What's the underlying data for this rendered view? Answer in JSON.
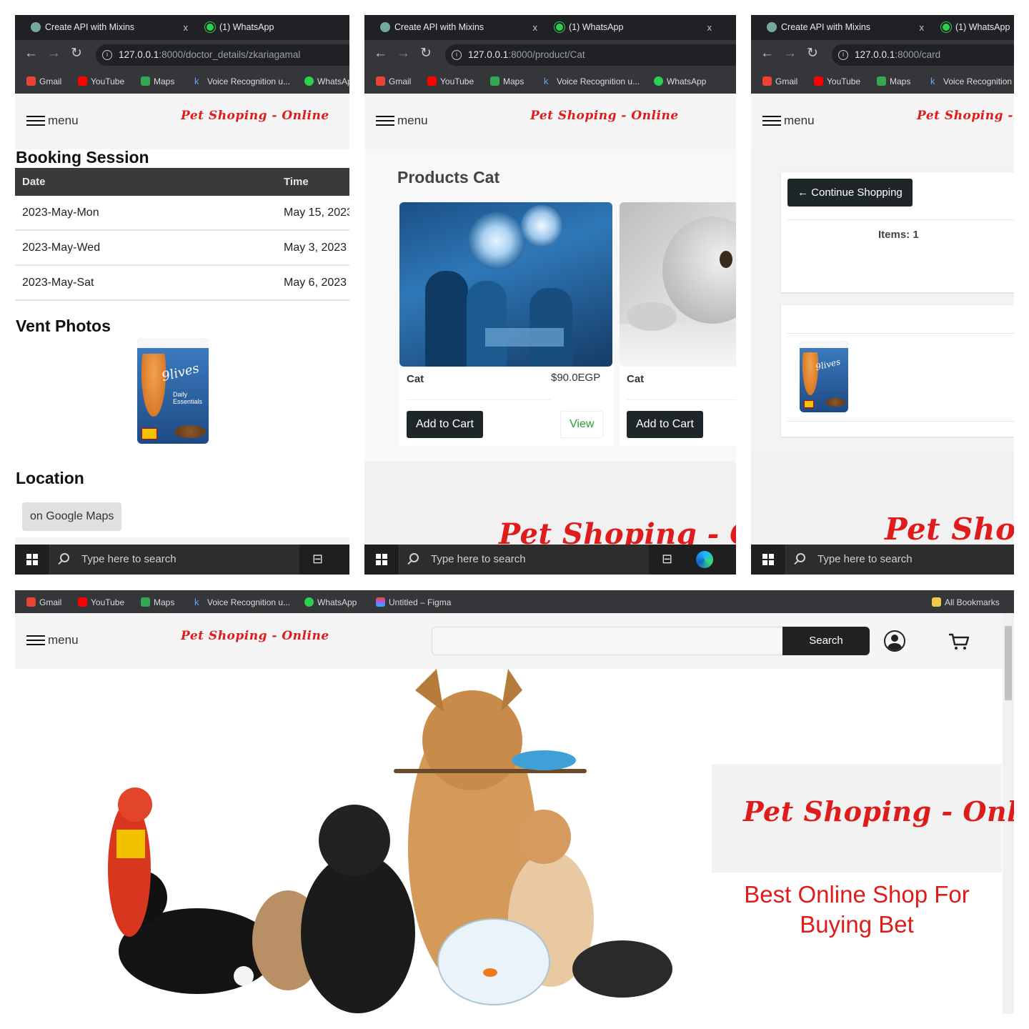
{
  "browser": {
    "tabs": [
      {
        "title": "Create API with Mixins",
        "close": "x",
        "icon": "chatgpt-icon"
      },
      {
        "title": "(1) WhatsApp",
        "close": "x",
        "icon": "whatsapp-icon"
      }
    ],
    "bookmarks": [
      "Gmail",
      "YouTube",
      "Maps",
      "Voice Recognition u...",
      "WhatsApp",
      "Untitled – Figma"
    ],
    "all_bookmarks": "All Bookmarks"
  },
  "panel1": {
    "url_host": "127.0.0.1",
    "url_rest": ":8000/doctor_details/zkariagamal",
    "menu_label": "menu",
    "logo": "Pet Shoping - Online",
    "booking_title": "Booking Session",
    "table": {
      "headers": [
        "Date",
        "Time"
      ],
      "rows": [
        [
          "2023-May-Mon",
          "May 15, 2023"
        ],
        [
          "2023-May-Wed",
          "May 3, 2023"
        ],
        [
          "2023-May-Sat",
          "May 6, 2023"
        ]
      ]
    },
    "vent_title": "Vent Photos",
    "product_brand": "9lives",
    "product_sub": "Daily Essentials",
    "location_title": "Location",
    "maps_button": "on Google Maps",
    "taskbar_search": "Type here to search"
  },
  "panel2": {
    "url_host": "127.0.0.1",
    "url_rest": ":8000/product/Cat",
    "menu_label": "menu",
    "logo": "Pet Shoping - Online",
    "section_title": "Products Cat",
    "products": [
      {
        "name": "Cat",
        "price": "$90.0EGP",
        "add_label": "Add to Cart",
        "view_label": "View"
      },
      {
        "name": "Cat",
        "add_label": "Add to Cart"
      }
    ],
    "footer_logo": "Pet Shoping - Online",
    "taskbar_search": "Type here to search"
  },
  "panel3": {
    "url_host": "127.0.0.1",
    "url_rest": ":8000/card",
    "menu_label": "menu",
    "logo": "Pet Shoping - Online",
    "continue_label": "← Continue Shopping",
    "items_label": "Items: 1",
    "footer_logo": "Pet Shoping",
    "taskbar_search": "Type here to search"
  },
  "panel4": {
    "menu_label": "menu",
    "logo": "Pet Shoping - Online",
    "search_placeholder": "",
    "search_button": "Search",
    "hero_logo": "Pet Shoping - Online",
    "tagline": "Best Online Shop For Buying Bet"
  },
  "colors": {
    "brand_red": "#e01b1b",
    "dark_button": "#1f2629",
    "chrome_dark": "#202124",
    "chrome_toolbar": "#35363a"
  }
}
